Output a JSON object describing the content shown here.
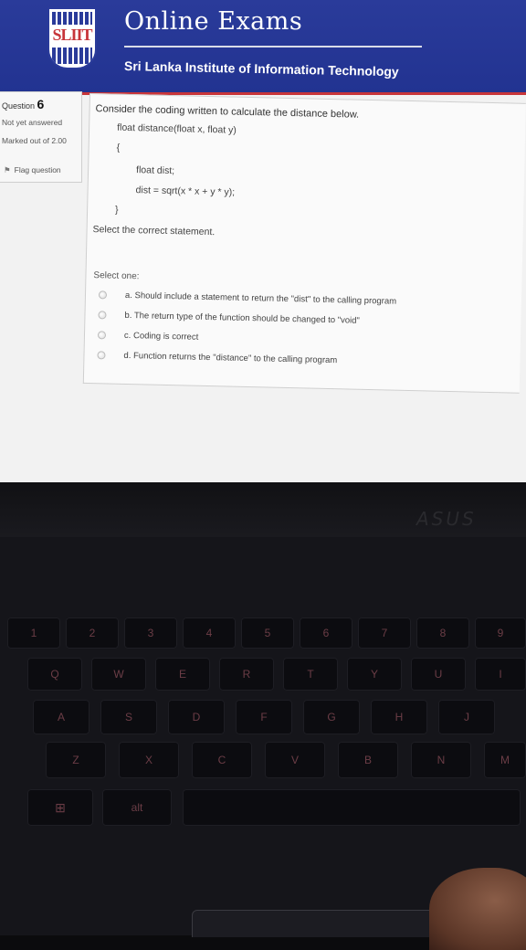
{
  "header": {
    "logo_text": "SLIIT",
    "app_title": "Online Exams",
    "org_name": "Sri Lanka Institute of Information Technology"
  },
  "question_info": {
    "label": "Question",
    "number": "6",
    "state": "Not yet answered",
    "marked_out_of": "Marked out of 2.00",
    "flag_label": "Flag question"
  },
  "question": {
    "text": "Consider the coding written to calculate the distance below.",
    "code": [
      "float distance(float x, float y)",
      "{",
      "float dist;",
      "dist = sqrt(x * x + y * y);",
      "}"
    ],
    "prompt": "Select the correct statement.",
    "select_one": "Select one:",
    "options": [
      "a. Should include a statement to return the \"dist\" to the calling program",
      "b. The return type of the function should be changed to \"void\"",
      "c. Coding is correct",
      "d. Function returns the \"distance\" to the calling program"
    ]
  },
  "laptop": {
    "brand": "ASUS",
    "keys": [
      "1",
      "2",
      "3",
      "4",
      "5",
      "6",
      "7",
      "8",
      "9",
      "Q",
      "W",
      "E",
      "R",
      "T",
      "Y",
      "U",
      "I",
      "A",
      "S",
      "D",
      "F",
      "G",
      "H",
      "J",
      "Z",
      "X",
      "C",
      "V",
      "B",
      "N",
      "M",
      "alt"
    ]
  },
  "colors": {
    "header_blue": "#223391",
    "header_red": "#c7353a"
  }
}
